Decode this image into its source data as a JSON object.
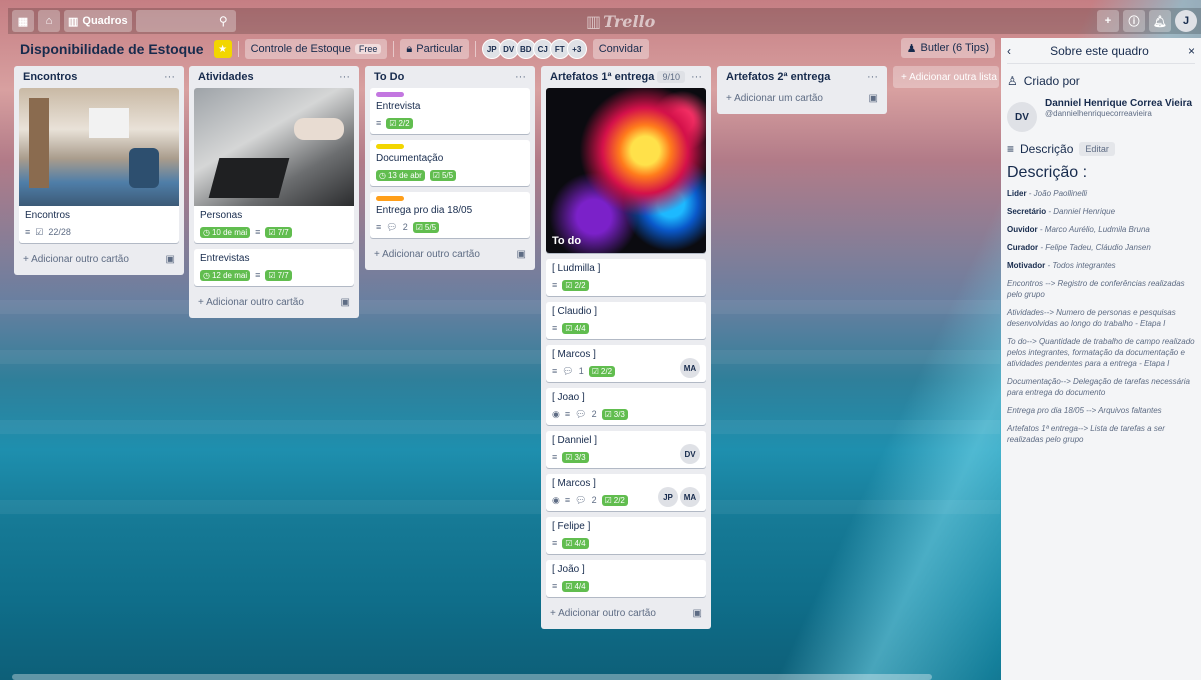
{
  "topbar": {
    "boards_label": "Quadros",
    "logo": "Trello"
  },
  "header": {
    "title": "Disponibilidade de Estoque",
    "team": "Controle de Estoque",
    "team_badge": "Free",
    "visibility": "Particular",
    "members": [
      "JP",
      "DV",
      "BD",
      "CJ",
      "FT"
    ],
    "more_members": "+3",
    "invite": "Convidar",
    "butler": "Butler (6 Tips)"
  },
  "lists": [
    {
      "title": "Encontros",
      "cards": [
        {
          "title": "Encontros",
          "checklist": "22/28"
        }
      ],
      "add": "+ Adicionar outro cartão"
    },
    {
      "title": "Atividades",
      "cards": [
        {
          "title": "Personas",
          "date": "10 de mai",
          "checklist": "7/7"
        },
        {
          "title": "Entrevistas",
          "date": "12 de mai",
          "checklist": "7/7"
        }
      ],
      "add": "+ Adicionar outro cartão"
    },
    {
      "title": "To Do",
      "cards": [
        {
          "title": "Entrevista",
          "checklist": "2/2",
          "label_color": "#c377e0"
        },
        {
          "title": "Documentação",
          "date": "13 de abr",
          "checklist": "5/5",
          "label_color": "#f2d600"
        },
        {
          "title": "Entrega pro dia 18/05",
          "comments": "2",
          "checklist": "5/5",
          "label_color": "#ff9f1a"
        }
      ],
      "add": "+ Adicionar outro cartão"
    },
    {
      "title": "Artefatos 1ª entrega",
      "count": "9/10",
      "cover_text": "To do",
      "cards": [
        {
          "title": "[ Ludmilla ]",
          "checklist": "2/2"
        },
        {
          "title": "[ Claudio ]",
          "checklist": "4/4"
        },
        {
          "title": "[ Marcos ]",
          "comments": "1",
          "checklist": "2/2",
          "member": "MA"
        },
        {
          "title": "[ Joao ]",
          "comments": "2",
          "checklist": "3/3"
        },
        {
          "title": "[ Danniel ]",
          "checklist": "3/3",
          "member": "DV"
        },
        {
          "title": "[ Marcos ]",
          "comments": "2",
          "checklist": "2/2",
          "member": "JP",
          "member2": "MA"
        },
        {
          "title": "[ Felipe ]",
          "checklist": "4/4"
        },
        {
          "title": "[ João ]",
          "checklist": "4/4"
        }
      ],
      "add": "+ Adicionar outro cartão"
    },
    {
      "title": "Artefatos 2ª entrega",
      "add": "+ Adicionar um cartão"
    }
  ],
  "add_list": "+ Adicionar outra lista",
  "sidebar": {
    "title": "Sobre este quadro",
    "created_by": "Criado por",
    "creator_initials": "DV",
    "creator_name": "Danniel Henrique Correa Vieira",
    "creator_handle": "@dannielhenriquecorreavieira",
    "desc_label": "Descrição",
    "edit": "Editar",
    "desc_title": "Descrição :",
    "roles": [
      {
        "k": "Lider",
        "v": " - João Paollinelli"
      },
      {
        "k": "Secretário",
        "v": " - Danniel Henrique"
      },
      {
        "k": "Ouvidor",
        "v": " - Marco Aurélio, Ludmila Bruna"
      },
      {
        "k": "Curador",
        "v": " - Felipe Tadeu, Cláudio Jansen"
      },
      {
        "k": "Motivador",
        "v": " - Todos integrantes"
      }
    ],
    "notes": [
      "Encontros --> Registro de conferências realizadas pelo grupo",
      "Atividades--> Numero de personas e pesquisas desenvolvidas ao longo do trabalho - Etapa I",
      "To do--> Quantidade de trabalho de campo realizado pelos integrantes, formatação da documentação e atividades pendentes para a entrega - Etapa I",
      "Documentação--> Delegação de tarefas necessária para entrega do documento",
      "Entrega pro dia 18/05 --> Arquivos faltantes",
      "Artefatos 1ª entrega--> Lista de tarefas a ser realizadas pelo grupo"
    ]
  }
}
